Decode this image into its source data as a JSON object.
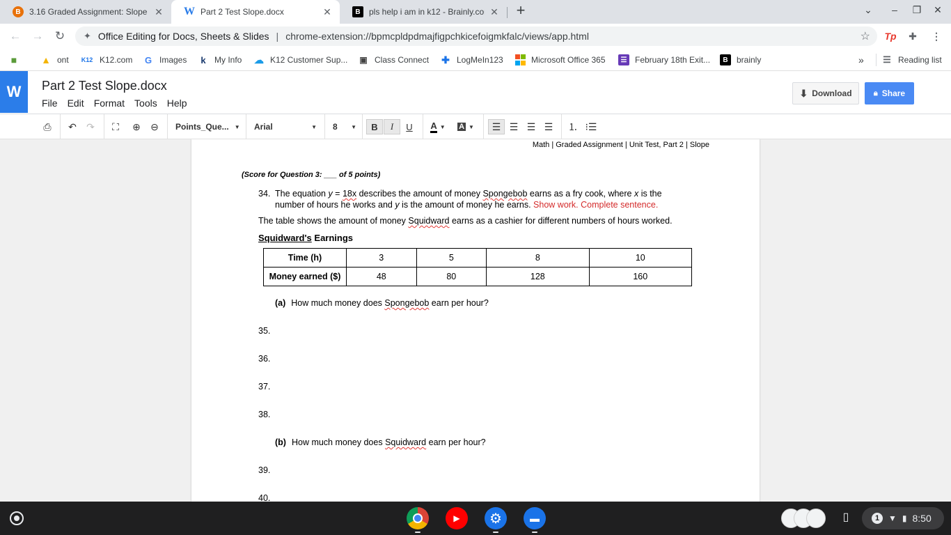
{
  "browser": {
    "tabs": [
      {
        "title": "3.16 Graded Assignment: Slope",
        "favicon": "brainly-b",
        "active": false
      },
      {
        "title": "Part 2 Test Slope.docx",
        "favicon": "w-logo",
        "active": true
      },
      {
        "title": "pls help i am in k12 - Brainly.com",
        "favicon": "brainly-b",
        "active": false
      }
    ],
    "new_tab_symbol": "+",
    "omnibox": {
      "site_name": "Office Editing for Docs, Sheets & Slides",
      "separator": "|",
      "url": "chrome-extension://bpmcpldpdmajfigpchkicefoigmkfalc/views/app.html"
    },
    "bookmarks": [
      {
        "label": "",
        "icon": "extension-icon"
      },
      {
        "label": "ont",
        "icon": "drive-icon"
      },
      {
        "label": "K12.com",
        "icon": "k12-icon"
      },
      {
        "label": "Images",
        "icon": "google-icon"
      },
      {
        "label": "My Info",
        "icon": "k12-icon"
      },
      {
        "label": "K12 Customer Sup...",
        "icon": "cloud-icon"
      },
      {
        "label": "Class Connect",
        "icon": "video-icon"
      },
      {
        "label": "LogMeIn123",
        "icon": "logmein-icon"
      },
      {
        "label": "Microsoft Office 365",
        "icon": "microsoft-icon"
      },
      {
        "label": "February 18th Exit...",
        "icon": "forms-icon"
      },
      {
        "label": "brainly",
        "icon": "brainly-icon"
      }
    ],
    "bookmarks_overflow": "»",
    "reading_list": "Reading list"
  },
  "app": {
    "logo": "W",
    "doc_title": "Part 2 Test Slope.docx",
    "menu": [
      "File",
      "Edit",
      "Format",
      "Tools",
      "Help"
    ],
    "download_label": "Download",
    "share_label": "Share"
  },
  "format_toolbar": {
    "style": "Points_Que...",
    "font": "Arial",
    "size": "8",
    "bold": "B",
    "italic": "I",
    "underline": "U",
    "text_color_label": "A",
    "highlight_label": "A"
  },
  "document": {
    "header": "Math | Graded Assignment | Unit Test, Part 2 | Slope",
    "score_line": "(Score for Question 3: ___ of 5 points)",
    "q34": {
      "number": "34.",
      "line1_a": "The equation ",
      "eq_y": "y",
      "eq_eq": " = ",
      "eq_rhs": "18x",
      "line1_b": " describes the amount of money ",
      "name1": "Spongebob",
      "line1_c": " earns as a fry cook, where ",
      "var_x": "x",
      "line1_d": " is the",
      "line2_a": "number of hours he works and ",
      "var_y": "y",
      "line2_b": " is the amount of money he earns. ",
      "instruction": "Show work. Complete sentence."
    },
    "intro_a": "The table shows the amount of money ",
    "intro_name": "Squidward",
    "intro_b": " earns as a cashier for different numbers of hours worked.",
    "table_title_ul": "Squidward's",
    "table_title_rest": " Earnings",
    "table": {
      "row1_label": "Time (h)",
      "row1": [
        "3",
        "5",
        "8",
        "10"
      ],
      "row2_label": "Money earned ($)",
      "row2": [
        "48",
        "80",
        "128",
        "160"
      ]
    },
    "part_a": {
      "tag": "(a)",
      "text_a": "How much money does ",
      "name": "Spongebob",
      "text_b": " earn per hour?"
    },
    "part_b": {
      "tag": "(b)",
      "text_a": "How much money does ",
      "name": "Squidward",
      "text_b": " earn per hour?"
    },
    "lines": [
      "35.",
      "36.",
      "37.",
      "38.",
      "39.",
      "40."
    ]
  },
  "shelf": {
    "apps": [
      "chrome-icon",
      "youtube-icon",
      "settings-icon",
      "files-icon"
    ],
    "notification_count": "1",
    "time": "8:50"
  }
}
